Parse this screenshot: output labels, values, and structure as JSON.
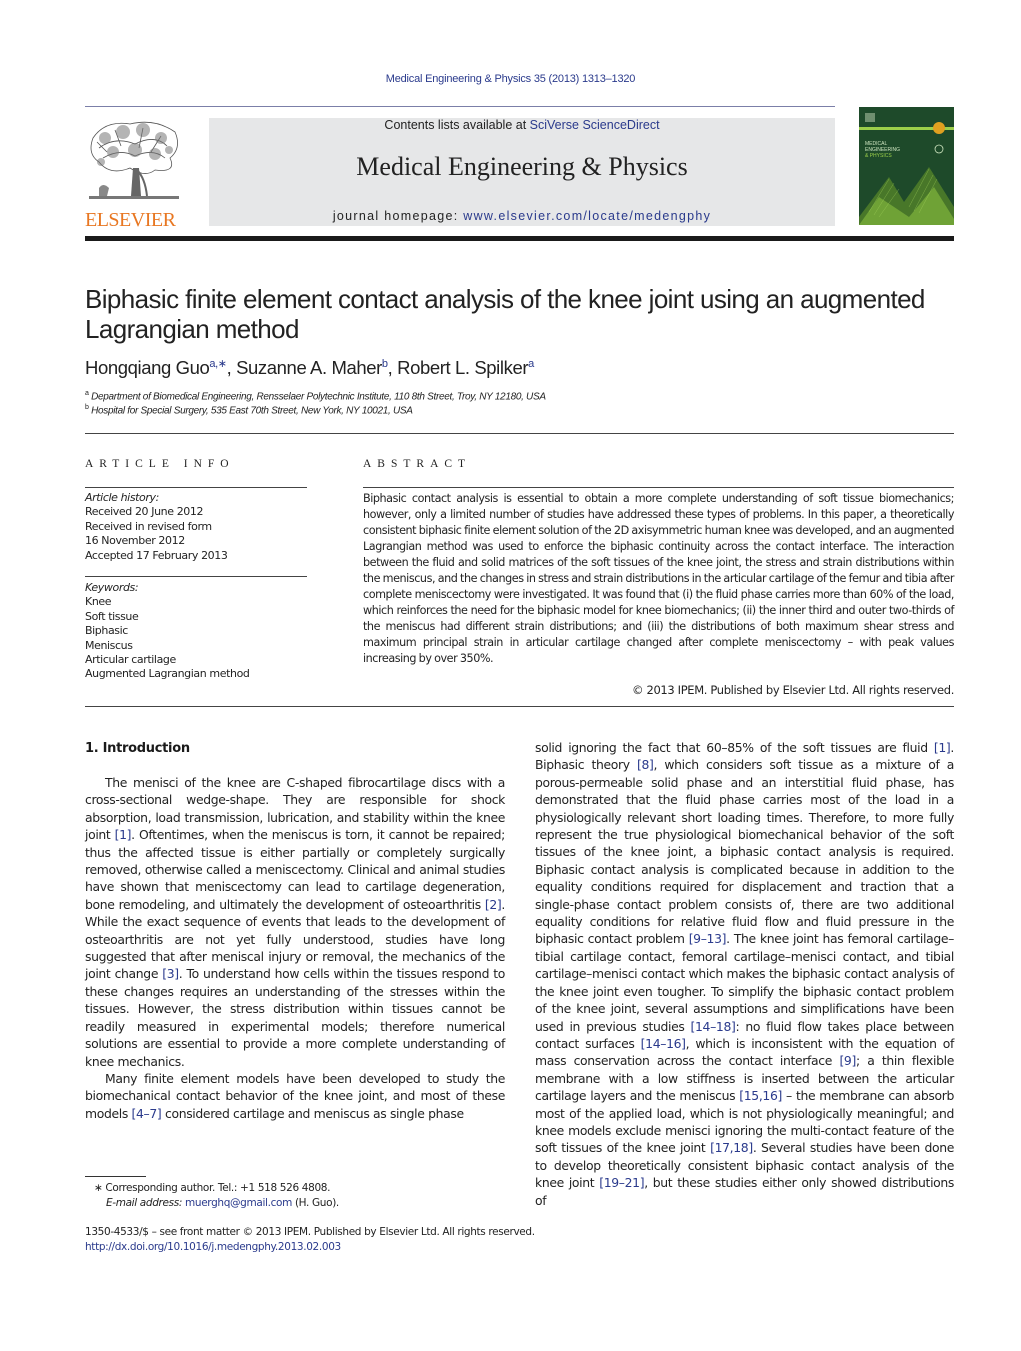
{
  "journal_reference": "Medical Engineering & Physics 35 (2013) 1313–1320",
  "masthead": {
    "publisher": "ELSEVIER",
    "contents_prefix": "Contents lists available at ",
    "contents_link": "SciVerse ScienceDirect",
    "journal_title": "Medical Engineering & Physics",
    "homepage_prefix": "journal homepage: ",
    "homepage_link": "www.elsevier.com/locate/medengphy",
    "cover_alt": "Medical Engineering & Physics journal cover"
  },
  "colors": {
    "link": "#2a3a8c",
    "elsevier_orange": "#e87722",
    "masthead_bg": "#e6e7e8",
    "cover_green": "#1e4a2a"
  },
  "article": {
    "title": "Biphasic finite element contact analysis of the knee joint using an augmented Lagrangian method",
    "authors": [
      {
        "name": "Hongqiang Guo",
        "marks": "a,∗"
      },
      {
        "name": "Suzanne A. Maher",
        "marks": "b"
      },
      {
        "name": "Robert L. Spilker",
        "marks": "a"
      }
    ],
    "affiliations": [
      {
        "mark": "a",
        "text": "Department of Biomedical Engineering, Rensselaer Polytechnic Institute, 110 8th Street, Troy, NY 12180, USA"
      },
      {
        "mark": "b",
        "text": "Hospital for Special Surgery, 535 East 70th Street, New York, NY 10021, USA"
      }
    ]
  },
  "article_info": {
    "heading": "ARTICLE INFO",
    "history_label": "Article history:",
    "history": [
      "Received 20 June 2012",
      "Received in revised form",
      "16 November 2012",
      "Accepted 17 February 2013"
    ],
    "keywords_label": "Keywords:",
    "keywords": [
      "Knee",
      "Soft tissue",
      "Biphasic",
      "Meniscus",
      "Articular cartilage",
      "Augmented Lagrangian method"
    ]
  },
  "abstract": {
    "heading": "ABSTRACT",
    "text": "Biphasic contact analysis is essential to obtain a more complete understanding of soft tissue biomechanics; however, only a limited number of studies have addressed these types of problems. In this paper, a theoretically consistent biphasic finite element solution of the 2D axisymmetric human knee was developed, and an augmented Lagrangian method was used to enforce the biphasic continuity across the contact interface. The interaction between the fluid and solid matrices of the soft tissues of the knee joint, the stress and strain distributions within the meniscus, and the changes in stress and strain distributions in the articular cartilage of the femur and tibia after complete meniscectomy were investigated. It was found that (i) the fluid phase carries more than 60% of the load, which reinforces the need for the biphasic model for knee biomechanics; (ii) the inner third and outer two-thirds of the meniscus had different strain distributions; and (iii) the distributions of both maximum shear stress and maximum principal strain in articular cartilage changed after complete meniscectomy – with peak values increasing by over 350%.",
    "copyright": "© 2013 IPEM. Published by Elsevier Ltd. All rights reserved."
  },
  "introduction": {
    "heading": "1.  Introduction",
    "left_paragraphs": [
      [
        {
          "t": "The menisci of the knee are C-shaped fibrocartilage discs with a cross-sectional wedge-shape. They are responsible for shock absorption, load transmission, lubrication, and stability within the knee joint "
        },
        {
          "c": "[1]"
        },
        {
          "t": ". Oftentimes, when the meniscus is torn, it cannot be repaired; thus the affected tissue is either partially or completely surgically removed, otherwise called a meniscectomy. Clinical and animal studies have shown that meniscectomy can lead to cartilage degeneration, bone remodeling, and ultimately the development of osteoarthritis "
        },
        {
          "c": "[2]"
        },
        {
          "t": ". While the exact sequence of events that leads to the development of osteoarthritis are not yet fully understood, studies have long suggested that after meniscal injury or removal, the mechanics of the joint change "
        },
        {
          "c": "[3]"
        },
        {
          "t": ". To understand how cells within the tissues respond to these changes requires an understanding of the stresses within the tissues. However, the stress distribution within tissues cannot be readily measured in experimental models; therefore numerical solutions are essential to provide a more complete understanding of knee mechanics."
        }
      ],
      [
        {
          "t": "Many finite element models have been developed to study the biomechanical contact behavior of the knee joint, and most of these models "
        },
        {
          "c": "[4–7]"
        },
        {
          "t": " considered cartilage and meniscus as single phase"
        }
      ]
    ],
    "right_paragraphs": [
      [
        {
          "t": "solid ignoring the fact that 60–85% of the soft tissues are fluid "
        },
        {
          "c": "[1]"
        },
        {
          "t": ". Biphasic theory "
        },
        {
          "c": "[8]"
        },
        {
          "t": ", which considers soft tissue as a mixture of a porous-permeable solid phase and an interstitial fluid phase, has demonstrated that the fluid phase carries most of the load in a physiologically relevant short loading times. Therefore, to more fully represent the true physiological biomechanical behavior of the soft tissues of the knee joint, a biphasic contact analysis is required. Biphasic contact analysis is complicated because in addition to the equality conditions required for displacement and traction that a single-phase contact problem consists of, there are two additional equality conditions for relative fluid flow and fluid pressure in the biphasic contact problem "
        },
        {
          "c": "[9–13]"
        },
        {
          "t": ". The knee joint has femoral cartilage–tibial cartilage contact, femoral cartilage–menisci contact, and tibial cartilage–menisci contact which makes the biphasic contact analysis of the knee joint even tougher. To simplify the biphasic contact problem of the knee joint, several assumptions and simplifications have been used in previous studies "
        },
        {
          "c": "[14–18]"
        },
        {
          "t": ": no fluid flow takes place between contact surfaces "
        },
        {
          "c": "[14–16]"
        },
        {
          "t": ", which is inconsistent with the equation of mass conservation across the contact interface "
        },
        {
          "c": "[9]"
        },
        {
          "t": "; a thin flexible membrane with a low stiffness is inserted between the articular cartilage layers and the meniscus "
        },
        {
          "c": "[15,16]"
        },
        {
          "t": " – the membrane can absorb most of the applied load, which is not physiologically meaningful; and knee models exclude menisci ignoring the multi-contact feature of the soft tissues of the knee joint "
        },
        {
          "c": "[17,18]"
        },
        {
          "t": ". Several studies have been done to develop theoretically consistent biphasic contact analysis of the knee joint "
        },
        {
          "c": "[19–21]"
        },
        {
          "t": ", but these studies either only showed distributions of"
        }
      ]
    ]
  },
  "footnotes": {
    "corresponding": "∗ Corresponding author. Tel.: +1 518 526 4808.",
    "email_label": "E-mail address: ",
    "email": "muerghq@gmail.com",
    "email_suffix": " (H. Guo)."
  },
  "front_matter": {
    "issn_line": "1350-4533/$ – see front matter © 2013 IPEM. Published by Elsevier Ltd. All rights reserved.",
    "doi": "http://dx.doi.org/10.1016/j.medengphy.2013.02.003"
  }
}
